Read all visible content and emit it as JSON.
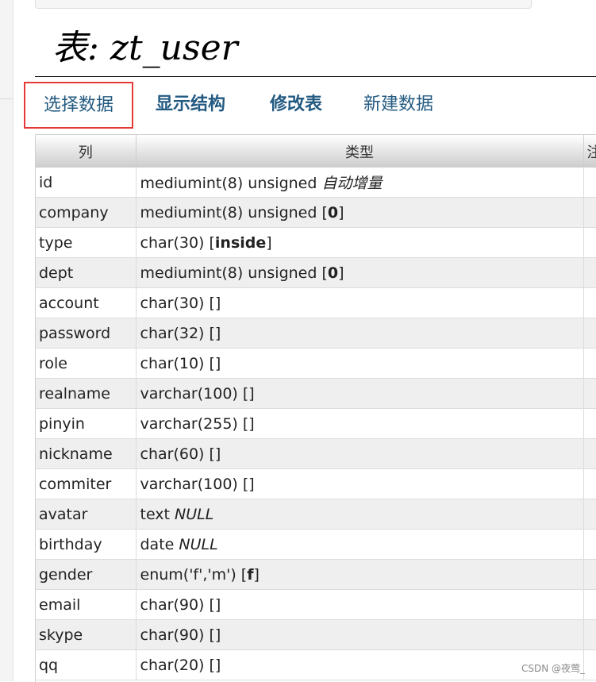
{
  "page": {
    "title": "表: zt_user"
  },
  "tabs": [
    {
      "label": "选择数据"
    },
    {
      "label": "显示结构"
    },
    {
      "label": "修改表"
    },
    {
      "label": "新建数据"
    }
  ],
  "table": {
    "headers": [
      "列",
      "类型",
      "注"
    ],
    "rows": [
      {
        "name": "id",
        "type": "mediumint(8) unsigned",
        "extra": "自动增量",
        "extra_style": "italic"
      },
      {
        "name": "company",
        "type": "mediumint(8) unsigned",
        "default": "0"
      },
      {
        "name": "type",
        "type": "char(30)",
        "default": "inside"
      },
      {
        "name": "dept",
        "type": "mediumint(8) unsigned",
        "default": "0"
      },
      {
        "name": "account",
        "type": "char(30)",
        "default": ""
      },
      {
        "name": "password",
        "type": "char(32)",
        "default": ""
      },
      {
        "name": "role",
        "type": "char(10)",
        "default": ""
      },
      {
        "name": "realname",
        "type": "varchar(100)",
        "default": ""
      },
      {
        "name": "pinyin",
        "type": "varchar(255)",
        "default": ""
      },
      {
        "name": "nickname",
        "type": "char(60)",
        "default": ""
      },
      {
        "name": "commiter",
        "type": "varchar(100)",
        "default": ""
      },
      {
        "name": "avatar",
        "type": "text",
        "extra": "NULL",
        "extra_style": "italic"
      },
      {
        "name": "birthday",
        "type": "date",
        "extra": "NULL",
        "extra_style": "italic"
      },
      {
        "name": "gender",
        "type": "enum('f','m')",
        "default": "f"
      },
      {
        "name": "email",
        "type": "char(90)",
        "default": ""
      },
      {
        "name": "skype",
        "type": "char(90)",
        "default": ""
      },
      {
        "name": "qq",
        "type": "char(20)",
        "default": ""
      }
    ]
  },
  "watermark": "CSDN @夜莺_",
  "colors": {
    "link": "#235a81",
    "highlight_border": "#e53935",
    "row_alt": "#efefef"
  }
}
